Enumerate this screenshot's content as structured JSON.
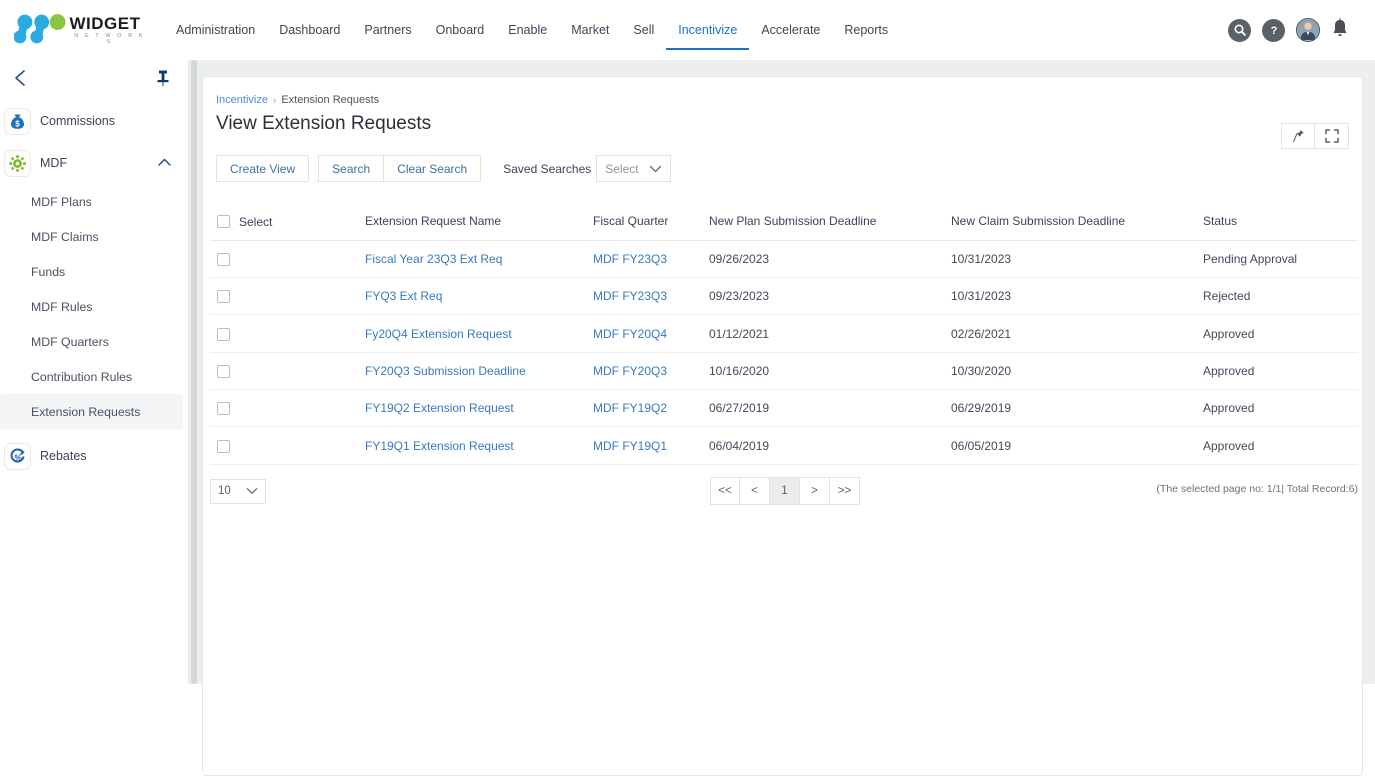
{
  "brand": {
    "name": "WIDGET",
    "tagline": "N E T W O R K S",
    "logo_blue": "#29abe2",
    "logo_green": "#8cc63e",
    "accent": "#1a73c7"
  },
  "topnav": {
    "items": [
      {
        "label": "Administration",
        "active": false
      },
      {
        "label": "Dashboard",
        "active": false
      },
      {
        "label": "Partners",
        "active": false
      },
      {
        "label": "Onboard",
        "active": false
      },
      {
        "label": "Enable",
        "active": false
      },
      {
        "label": "Market",
        "active": false
      },
      {
        "label": "Sell",
        "active": false
      },
      {
        "label": "Incentivize",
        "active": true
      },
      {
        "label": "Accelerate",
        "active": false
      },
      {
        "label": "Reports",
        "active": false
      }
    ],
    "icons": [
      "search-icon",
      "help-icon",
      "user-avatar",
      "notification-bell-icon"
    ]
  },
  "sidebar": {
    "collapse_icon": "chevron-left-icon",
    "pin_icon": "pin-icon",
    "groups": [
      {
        "label": "Commissions",
        "icon": "money-bag-icon",
        "expanded": false,
        "items": []
      },
      {
        "label": "MDF",
        "icon": "mdf-sun-icon",
        "expanded": true,
        "caret": "chevron-up-icon",
        "items": [
          {
            "label": "MDF Plans",
            "active": false
          },
          {
            "label": "MDF Claims",
            "active": false
          },
          {
            "label": "Funds",
            "active": false
          },
          {
            "label": "MDF Rules",
            "active": false
          },
          {
            "label": "MDF Quarters",
            "active": false
          },
          {
            "label": "Contribution Rules",
            "active": false
          },
          {
            "label": "Extension Requests",
            "active": true
          }
        ]
      },
      {
        "label": "Rebates",
        "icon": "percent-circle-icon",
        "expanded": false,
        "items": []
      }
    ]
  },
  "breadcrumb": {
    "parent": "Incentivize",
    "separator": "›",
    "current": "Extension Requests"
  },
  "page": {
    "title": "View Extension Requests",
    "pin_icon": "pin-icon",
    "expand_icon": "fullscreen-icon"
  },
  "toolbar": {
    "create_view": "Create View",
    "search": "Search",
    "clear_search": "Clear Search",
    "saved_searches_label": "Saved Searches",
    "saved_searches_value": "Select"
  },
  "table": {
    "headers": {
      "select": "Select",
      "name": "Extension Request Name",
      "fiscal_quarter": "Fiscal Quarter",
      "plan_deadline": "New Plan Submission Deadline",
      "claim_deadline": "New Claim Submission Deadline",
      "status": "Status"
    },
    "rows": [
      {
        "name": "Fiscal Year 23Q3 Ext Req",
        "fiscal_quarter": "MDF FY23Q3",
        "plan_deadline": "09/26/2023",
        "claim_deadline": "10/31/2023",
        "status": "Pending Approval"
      },
      {
        "name": "FYQ3 Ext Req",
        "fiscal_quarter": "MDF FY23Q3",
        "plan_deadline": "09/23/2023",
        "claim_deadline": "10/31/2023",
        "status": "Rejected"
      },
      {
        "name": "Fy20Q4 Extension Request",
        "fiscal_quarter": "MDF FY20Q4",
        "plan_deadline": "01/12/2021",
        "claim_deadline": "02/26/2021",
        "status": "Approved"
      },
      {
        "name": "FY20Q3 Submission Deadline",
        "fiscal_quarter": "MDF FY20Q3",
        "plan_deadline": "10/16/2020",
        "claim_deadline": "10/30/2020",
        "status": "Approved"
      },
      {
        "name": "FY19Q2 Extension Request",
        "fiscal_quarter": "MDF FY19Q2",
        "plan_deadline": "06/27/2019",
        "claim_deadline": "06/29/2019",
        "status": "Approved"
      },
      {
        "name": "FY19Q1 Extension Request",
        "fiscal_quarter": "MDF FY19Q1",
        "plan_deadline": "06/04/2019",
        "claim_deadline": "06/05/2019",
        "status": "Approved"
      }
    ]
  },
  "footer": {
    "page_size": "10",
    "pager": [
      {
        "label": "<<",
        "current": false
      },
      {
        "label": "<",
        "current": false
      },
      {
        "label": "1",
        "current": true
      },
      {
        "label": ">",
        "current": false
      },
      {
        "label": ">>",
        "current": false
      }
    ],
    "record_info": "(The selected page no: 1/1| Total Record:6)"
  }
}
